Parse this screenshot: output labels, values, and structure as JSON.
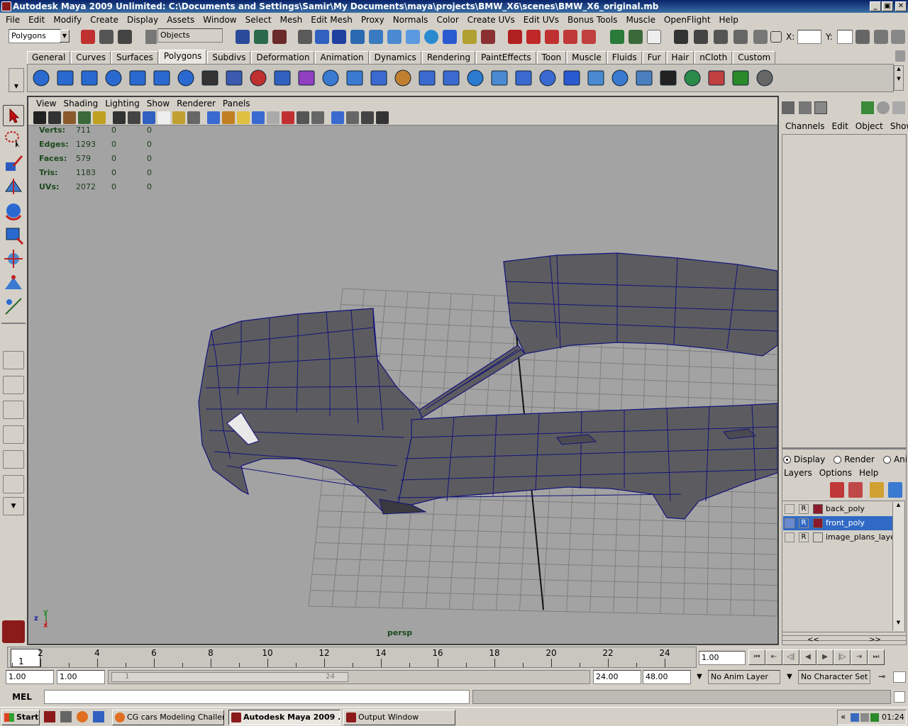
{
  "window": {
    "title": "Autodesk Maya 2009 Unlimited: C:\\Documents and Settings\\Samir\\My Documents\\maya\\projects\\BMW_X6\\scenes\\BMW_X6_original.mb",
    "minimize": "_",
    "maximize": "▣",
    "close": "✕"
  },
  "menus": [
    "File",
    "Edit",
    "Modify",
    "Create",
    "Display",
    "Assets",
    "Window",
    "Select",
    "Mesh",
    "Edit Mesh",
    "Proxy",
    "Normals",
    "Color",
    "Create UVs",
    "Edit UVs",
    "Bonus Tools",
    "Muscle",
    "OpenFlight",
    "Help"
  ],
  "statusline": {
    "menuset": "Polygons",
    "selection_mode": "Objects",
    "x_label": "X:",
    "y_label": "Y:"
  },
  "shelf_tabs": [
    "General",
    "Curves",
    "Surfaces",
    "Polygons",
    "Subdivs",
    "Deformation",
    "Animation",
    "Dynamics",
    "Rendering",
    "PaintEffects",
    "Toon",
    "Muscle",
    "Fluids",
    "Fur",
    "Hair",
    "nCloth",
    "Custom"
  ],
  "active_shelf": "Polygons",
  "panel": {
    "menus": [
      "View",
      "Shading",
      "Lighting",
      "Show",
      "Renderer",
      "Panels"
    ],
    "camera_label": "persp",
    "axis_y": "y",
    "axis_z": "z",
    "axis_x": "x"
  },
  "hud": {
    "rows": [
      {
        "label": "Verts:",
        "a": "711",
        "b": "0",
        "c": "0"
      },
      {
        "label": "Edges:",
        "a": "1293",
        "b": "0",
        "c": "0"
      },
      {
        "label": "Faces:",
        "a": "579",
        "b": "0",
        "c": "0"
      },
      {
        "label": "Tris:",
        "a": "1183",
        "b": "0",
        "c": "0"
      },
      {
        "label": "UVs:",
        "a": "2072",
        "b": "0",
        "c": "0"
      }
    ]
  },
  "channelbox": {
    "menus": [
      "Channels",
      "Edit",
      "Object",
      "Show"
    ]
  },
  "layer_editor": {
    "radios": [
      "Display",
      "Render",
      "Anim"
    ],
    "menus": [
      "Layers",
      "Options",
      "Help"
    ],
    "layers": [
      {
        "r": "R",
        "name": "back_poly",
        "selected": false
      },
      {
        "r": "R",
        "name": "front_poly",
        "selected": true
      },
      {
        "r": "R",
        "name": "image_plans_layer",
        "selected": false
      }
    ],
    "scroll_left": "<<",
    "scroll_right": ">>"
  },
  "timeline": {
    "current_frame": "1",
    "ticks": [
      "2",
      "4",
      "6",
      "8",
      "10",
      "12",
      "14",
      "16",
      "18",
      "20",
      "22",
      "24"
    ],
    "current_time_field": "1.00"
  },
  "range": {
    "start": "1.00",
    "playback_start": "1.00",
    "slider_start": "1",
    "slider_end": "24",
    "playback_end": "24.00",
    "end": "48.00",
    "anim_layer": "No Anim Layer",
    "character_set": "No Character Set"
  },
  "command": {
    "mode_label": "MEL",
    "input_value": ""
  },
  "taskbar": {
    "start_label": "Start",
    "tasks": [
      {
        "label": "CG cars Modeling Challen...",
        "active": false
      },
      {
        "label": "Autodesk Maya 2009 ...",
        "active": true
      },
      {
        "label": "Output Window",
        "active": false
      }
    ],
    "tray_expand": "«",
    "clock": "01:24"
  },
  "colors": {
    "title_bar": "#0a246a",
    "viewport_bg": "#a3a3a3",
    "mesh_face": "#5a5a5e",
    "mesh_wire": "#13137a",
    "layer_selected": "#316ac5",
    "layer_color": "#8b1a2a"
  }
}
